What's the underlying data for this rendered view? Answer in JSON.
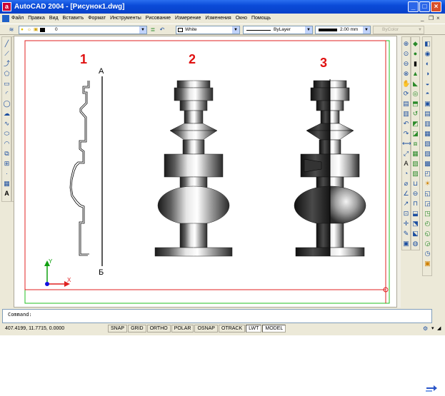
{
  "window": {
    "title": "AutoCAD 2004 - [Рисунок1.dwg]",
    "icon": "autocad-logo-icon",
    "minimize_glyph": "_",
    "maximize_glyph": "□",
    "close_glyph": "×"
  },
  "menu": {
    "items": [
      "Файл",
      "Правка",
      "Вид",
      "Вставить",
      "Формат",
      "Инструменты",
      "Рисование",
      "Измерение",
      "Изменения",
      "Окно",
      "Помощь"
    ],
    "doc_minimize": "_",
    "doc_restore": "❐",
    "doc_close": "×"
  },
  "properties_toolbar": {
    "layer_value": "0",
    "color_value": "White",
    "linetype_value": "ByLayer",
    "lineweight_value": "2.00 mm",
    "plotstyle_value": "ByColor"
  },
  "drawing": {
    "labels": [
      "1",
      "2",
      "3"
    ],
    "axis_top_label": "А",
    "axis_bottom_label": "Б",
    "ucs_x": "X",
    "ucs_y": "Y",
    "colors": {
      "label_red": "#e01010",
      "frame_green": "#22c022",
      "frame_red": "#e02020",
      "ucs_green": "#10a010",
      "ucs_red": "#e02020",
      "ucs_blue": "#1010e0"
    }
  },
  "command": {
    "prompt": "Command:"
  },
  "status": {
    "coords": "407.4199, 11.7715, 0.0000",
    "modes": [
      {
        "label": "SNAP",
        "on": false
      },
      {
        "label": "GRID",
        "on": false
      },
      {
        "label": "ORTHO",
        "on": false
      },
      {
        "label": "POLAR",
        "on": false
      },
      {
        "label": "OSNAP",
        "on": false
      },
      {
        "label": "OTRACK",
        "on": false
      },
      {
        "label": "LWT",
        "on": true
      },
      {
        "label": "MODEL",
        "on": true
      }
    ]
  }
}
